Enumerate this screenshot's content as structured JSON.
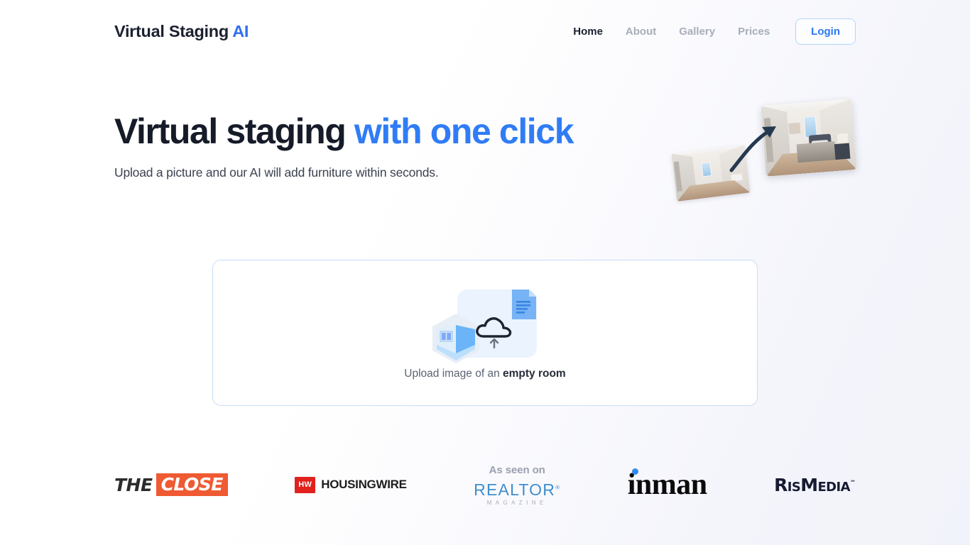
{
  "header": {
    "brand_main": "Virtual Staging ",
    "brand_accent": "AI",
    "nav": [
      {
        "label": "Home",
        "active": true
      },
      {
        "label": "About",
        "active": false
      },
      {
        "label": "Gallery",
        "active": false
      },
      {
        "label": "Prices",
        "active": false
      }
    ],
    "login_label": "Login"
  },
  "hero": {
    "title_plain": "Virtual staging ",
    "title_accent": "with one click",
    "subtitle": "Upload a picture and our AI will add furniture within seconds.",
    "illustration": {
      "before_alt": "empty room photo",
      "after_alt": "virtually staged bedroom photo",
      "arrow": "curved-arrow-icon"
    }
  },
  "upload": {
    "caption_plain": "Upload image of an ",
    "caption_bold": "empty room",
    "icons": {
      "panel": "upload-panel",
      "document": "document-icon",
      "cube": "isometric-room-icon",
      "cloud": "cloud-upload-icon"
    }
  },
  "press": {
    "as_seen_on": "As seen on",
    "logos": [
      {
        "id": "the-close",
        "word1": "THE",
        "word2": "CLOSE"
      },
      {
        "id": "housingwire",
        "badge": "HW",
        "word": "HOUSINGWIRE"
      },
      {
        "id": "realtor-magazine",
        "word": "REALTOR",
        "registered": "®",
        "sub": "MAGAZINE"
      },
      {
        "id": "inman",
        "word": "inman"
      },
      {
        "id": "rismedia",
        "word_r": "R",
        "word_is": "IS",
        "word_m": "M",
        "word_edia": "EDIA",
        "tm": "™"
      }
    ]
  },
  "colors": {
    "accent_blue": "#2f7cf6",
    "text_dark": "#151b28",
    "text_muted": "#a8adbb",
    "border_blue": "#c7ddf7",
    "panel_blue": "#eaf3fe",
    "orange": "#ef5a33",
    "red": "#e0211c",
    "navy": "#161b33"
  }
}
